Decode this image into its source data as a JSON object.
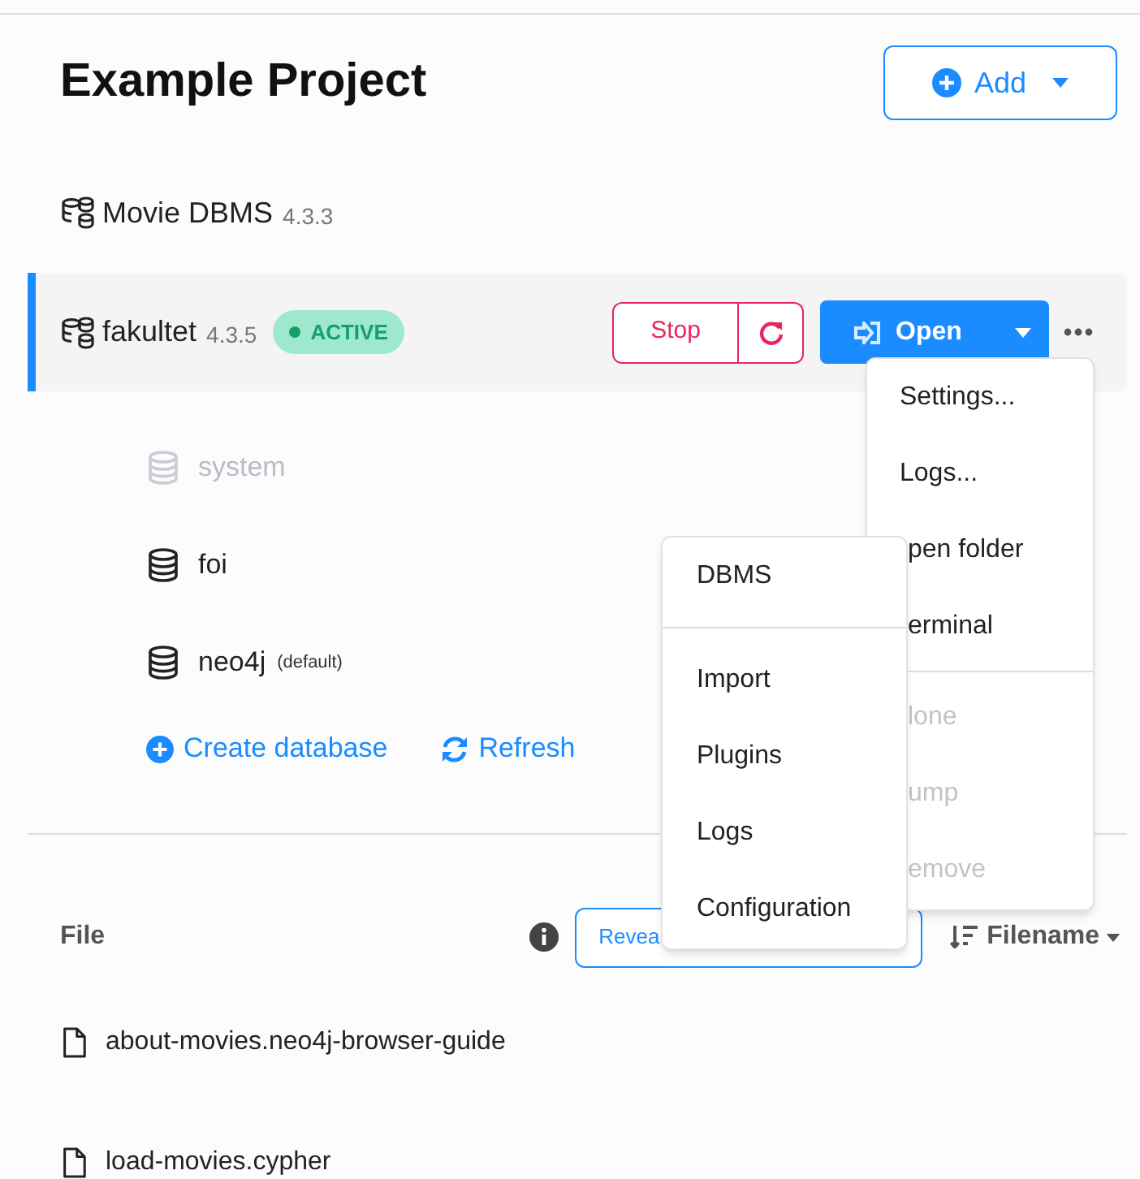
{
  "project": {
    "title": "Example Project",
    "add_button": "Add"
  },
  "dbms": [
    {
      "name": "Movie DBMS",
      "version": "4.3.3",
      "active": false
    },
    {
      "name": "fakultet",
      "version": "4.3.5",
      "active": true,
      "status": "ACTIVE",
      "stop_button": "Stop",
      "open_button": "Open"
    }
  ],
  "databases": [
    {
      "name": "system",
      "disabled": true
    },
    {
      "name": "foi",
      "disabled": false
    },
    {
      "name": "neo4j",
      "disabled": false,
      "tag": "(default)"
    }
  ],
  "database_actions": [
    {
      "kind": "create",
      "label": "Create database"
    },
    {
      "kind": "refresh",
      "label": "Refresh"
    }
  ],
  "dbms_menu": [
    [
      {
        "label": "Settings...",
        "disabled": false
      },
      {
        "label": "Logs...",
        "disabled": false
      },
      {
        "label": "pen folder",
        "disabled": false
      },
      {
        "label": "erminal",
        "disabled": false
      }
    ],
    [
      {
        "label": "lone",
        "disabled": true
      },
      {
        "label": "ump",
        "disabled": true
      },
      {
        "label": "emove",
        "disabled": true
      }
    ]
  ],
  "open_menu": [
    [
      {
        "label": "DBMS"
      }
    ],
    [
      {
        "label": "Import"
      },
      {
        "label": "Plugins"
      },
      {
        "label": "Logs"
      },
      {
        "label": "Configuration"
      }
    ]
  ],
  "files": {
    "column": "File",
    "reveal_button": "Revea",
    "sort": "Filename",
    "rows": [
      {
        "name": "about-movies.neo4j-browser-guide"
      },
      {
        "name": "load-movies.cypher"
      }
    ]
  }
}
